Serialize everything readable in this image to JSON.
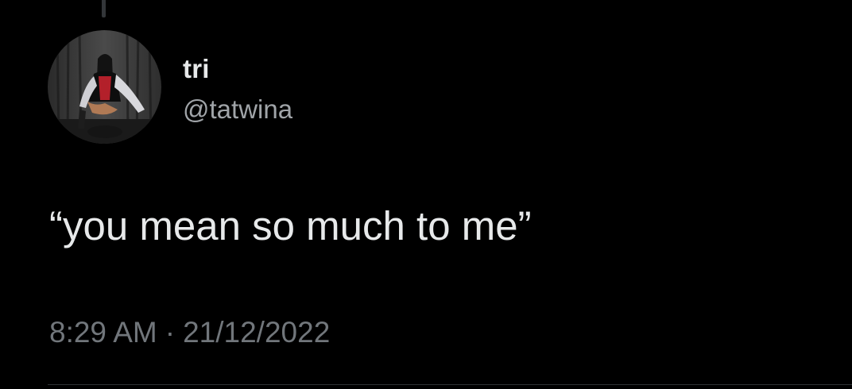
{
  "tweet": {
    "author": {
      "display_name": "tri",
      "handle": "@tatwina",
      "avatar_icon": "profile-photo"
    },
    "text": "“you mean so much to me”",
    "time": "8:29 AM",
    "separator": "·",
    "date": "21/12/2022"
  },
  "colors": {
    "background": "#000000",
    "primary_text": "#e7e9ea",
    "secondary_text": "#71767b",
    "divider": "#2f3336"
  }
}
